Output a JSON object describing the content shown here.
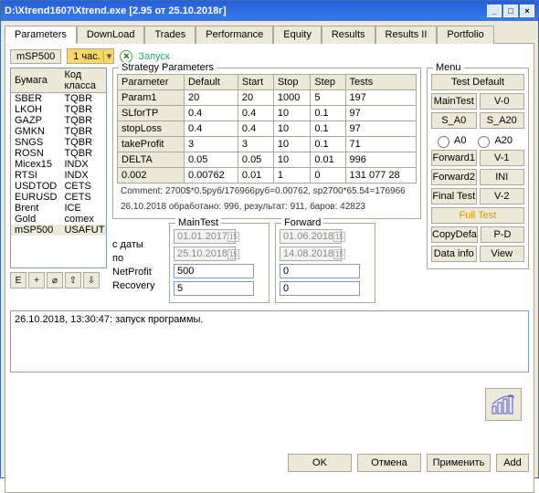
{
  "window": {
    "title": "D:\\Xtrend1607\\Xtrend.exe   [2.95 от 25.10.2018г]"
  },
  "tabs": [
    "Parameters",
    "DownLoad",
    "Trades",
    "Performance",
    "Equity",
    "Results",
    "Results II",
    "Portfolio"
  ],
  "top": {
    "symbol": "mSP500",
    "period": "1 час.",
    "launch": "Запуск"
  },
  "symlist": {
    "headers": [
      "Бумага",
      "Код класса"
    ],
    "rows": [
      [
        "SBER",
        "TQBR"
      ],
      [
        "LKOH",
        "TQBR"
      ],
      [
        "GAZP",
        "TQBR"
      ],
      [
        "GMKN",
        "TQBR"
      ],
      [
        "SNGS",
        "TQBR"
      ],
      [
        "ROSN",
        "TQBR"
      ],
      [
        "Micex15",
        "INDX"
      ],
      [
        "RTSI",
        "INDX"
      ],
      [
        "USDTOD",
        "CETS"
      ],
      [
        "EURUSD",
        "CETS"
      ],
      [
        "Brent",
        "ICE"
      ],
      [
        "Gold",
        "comex"
      ],
      [
        "mSP500",
        "USAFUT"
      ]
    ],
    "small_buttons": [
      "E",
      "+",
      "⌀",
      "⇧",
      "⇩"
    ]
  },
  "strategy": {
    "title": "Strategy Parameters",
    "headers": [
      "Parameter",
      "Default",
      "Start",
      "Stop",
      "Step",
      "Tests"
    ],
    "rows": [
      [
        "Param1",
        "20",
        "20",
        "1000",
        "5",
        "197"
      ],
      [
        "SLforTP",
        "0.4",
        "0.4",
        "10",
        "0.1",
        "97"
      ],
      [
        "stopLoss",
        "0.4",
        "0.4",
        "10",
        "0.1",
        "97"
      ],
      [
        "takeProfit",
        "3",
        "3",
        "10",
        "0.1",
        "71"
      ],
      [
        "DELTA",
        "0.05",
        "0.05",
        "10",
        "0.01",
        "996"
      ],
      [
        "",
        "0.002",
        "0.00762",
        "0.01",
        "1",
        "0",
        "131 077 28"
      ]
    ],
    "comment": "Comment: 2700$*0.5руб/176966руб=0.00762, sp2700*65.54=176966",
    "status": "26.10.2018  обработано: 996, результат: 911, баров: 42823"
  },
  "dates": {
    "from_lbl": "с даты",
    "to_lbl": "по",
    "np_lbl": "NetProfit",
    "rec_lbl": "Recovery",
    "maintest": {
      "title": "MainTest",
      "from": "01.01.2017",
      "to": "25.10.2018",
      "np": "500",
      "rec": "5"
    },
    "forward": {
      "title": "Forward",
      "from": "01.06.2018",
      "to": "14.08.2018",
      "np": "0",
      "rec": "0"
    }
  },
  "menu": {
    "title": "Menu",
    "testdefault": "Test Default",
    "maintest": "MainTest",
    "v0": "V-0",
    "sa0": "S_A0",
    "sa20": "S_A20",
    "ra0": "A0",
    "ra20": "A20",
    "fwd1": "Forward1",
    "v1": "V-1",
    "fwd2": "Forward2",
    "ini": "INI",
    "final": "Final Test",
    "v2": "V-2",
    "full": "Full Test",
    "copy": "CopyDefa",
    "pd": "P-D",
    "data": "Data info",
    "view": "View"
  },
  "log": "26.10.2018, 13:30:47: запуск программы.",
  "bottom": {
    "ok": "OK",
    "cancel": "Отмена",
    "apply": "Применить",
    "add": "Add"
  }
}
